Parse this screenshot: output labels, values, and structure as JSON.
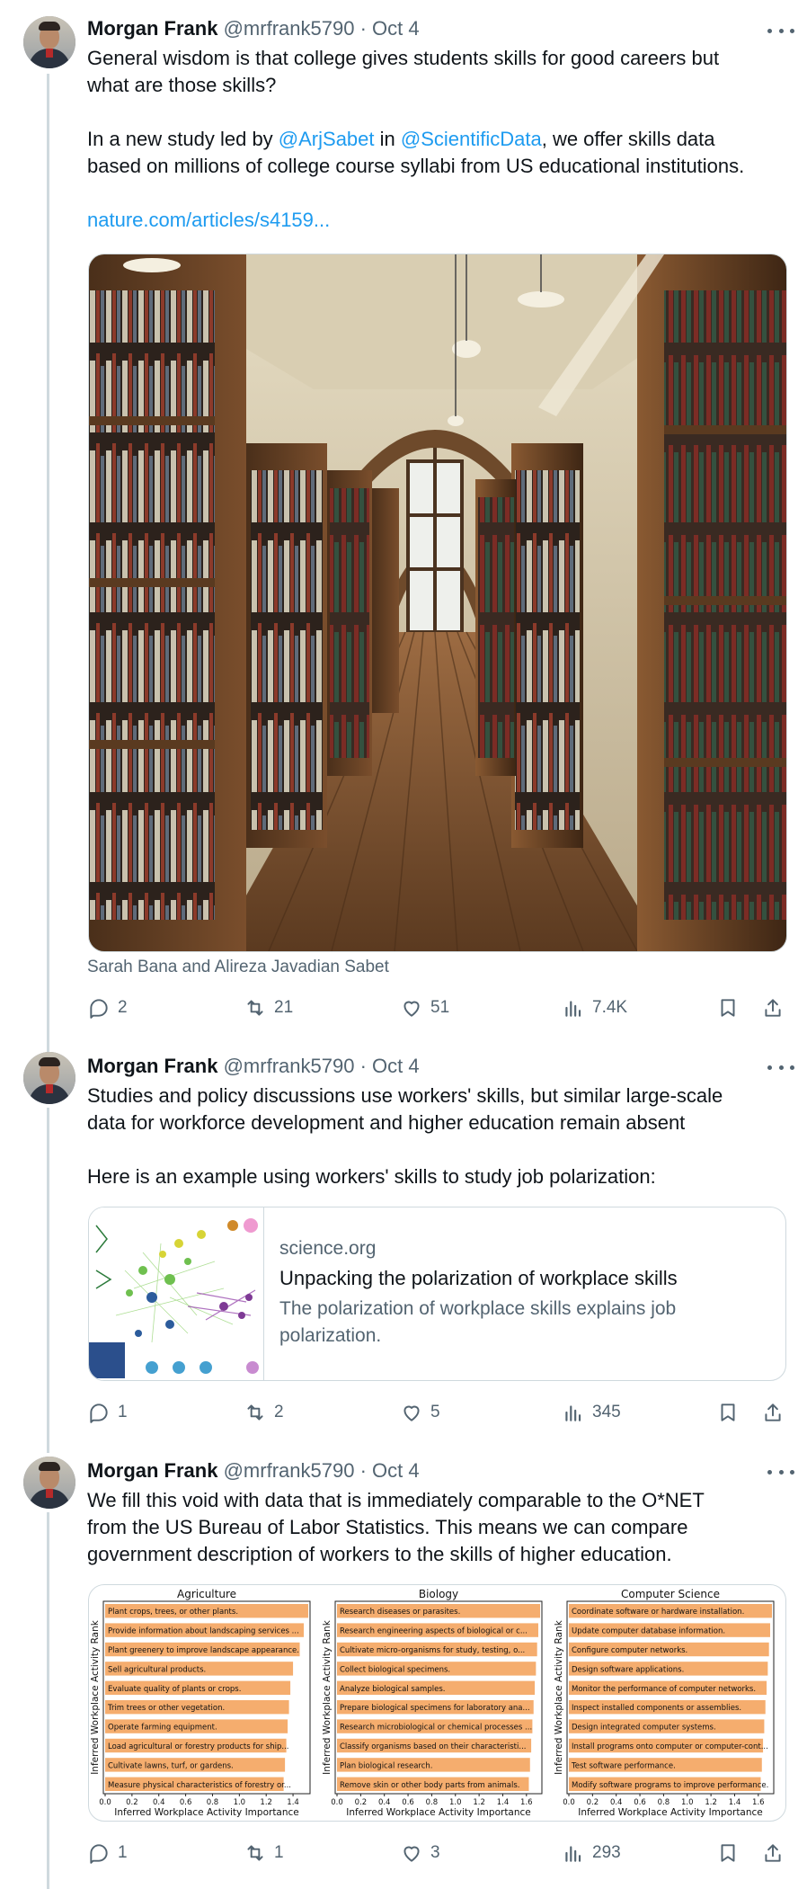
{
  "tweets": [
    {
      "name": "Morgan Frank",
      "handle": "@mrfrank5790",
      "dot": "·",
      "date": "Oct 4",
      "text_lines": [
        "General wisdom is that college gives students skills for good careers but",
        "what are those skills?"
      ],
      "para2_prefix": "In a new study led by ",
      "mention1": "@ArjSabet",
      "para2_mid": " in ",
      "mention2": "@ScientificData",
      "para2_suffix": ", we offer skills data",
      "para2_line2": "based on millions of college course syllabi from US educational institutions.",
      "link": "nature.com/articles/s4159...",
      "caption": "Sarah Bana and Alireza Javadian Sabet",
      "replies": "2",
      "retweets": "21",
      "likes": "51",
      "views": "7.4K"
    },
    {
      "name": "Morgan Frank",
      "handle": "@mrfrank5790",
      "dot": "·",
      "date": "Oct 4",
      "text_lines": [
        "Studies and policy discussions use workers' skills, but similar large-scale",
        "data for workforce development and higher education remain absent"
      ],
      "text_line3": "Here is an example using workers' skills to study job polarization:",
      "card": {
        "domain": "science.org",
        "title": "Unpacking the polarization of workplace skills",
        "description": "The polarization of workplace skills explains job polarization."
      },
      "replies": "1",
      "retweets": "2",
      "likes": "5",
      "views": "345"
    },
    {
      "name": "Morgan Frank",
      "handle": "@mrfrank5790",
      "dot": "·",
      "date": "Oct 4",
      "text_lines": [
        "We fill this void with data that is immediately comparable to the O*NET",
        "from the US Bureau of Labor Statistics. This means we can compare",
        "government description of workers to the skills of higher education."
      ],
      "replies": "1",
      "retweets": "1",
      "likes": "3",
      "views": "293"
    }
  ],
  "chart_data": [
    {
      "type": "bar",
      "title": "Agriculture",
      "ylabel": "Inferred Workplace Activity Rank",
      "xlabel": "Inferred Workplace Activity Importance",
      "xlim": [
        0,
        1.5
      ],
      "xticks": [
        "0.0",
        "0.2",
        "0.4",
        "0.6",
        "0.8",
        "1.0",
        "1.2",
        "1.4"
      ],
      "bar_color": "#f5ad6e",
      "categories": [
        "Plant crops, trees, or other plants.",
        "Provide information about landscaping services ...",
        "Plant greenery to improve landscape appearance.",
        "Sell agricultural products.",
        "Evaluate quality of plants or crops.",
        "Trim trees or other vegetation.",
        "Operate farming equipment.",
        "Load agricultural or forestry products for ship...",
        "Cultivate lawns, turf, or gardens.",
        "Measure physical characteristics of forestry or..."
      ],
      "values": [
        1.55,
        1.48,
        1.45,
        1.4,
        1.38,
        1.37,
        1.36,
        1.35,
        1.34,
        1.33
      ]
    },
    {
      "type": "bar",
      "title": "Biology",
      "ylabel": "Inferred Workplace Activity Rank",
      "xlabel": "Inferred Workplace Activity Importance",
      "xlim": [
        0,
        1.7
      ],
      "xticks": [
        "0.0",
        "0.2",
        "0.4",
        "0.6",
        "0.8",
        "1.0",
        "1.2",
        "1.4",
        "1.6"
      ],
      "bar_color": "#f5ad6e",
      "categories": [
        "Research diseases or parasites.",
        "Research engineering aspects of biological or c...",
        "Cultivate micro-organisms for study, testing, o...",
        "Collect biological specimens.",
        "Analyze biological samples.",
        "Prepare biological specimens for laboratory ana...",
        "Research microbiological or chemical processes ...",
        "Classify organisms based on their characteristi...",
        "Plan biological research.",
        "Remove skin or other body parts from animals."
      ],
      "values": [
        1.74,
        1.7,
        1.69,
        1.68,
        1.67,
        1.66,
        1.65,
        1.64,
        1.63,
        1.62
      ]
    },
    {
      "type": "bar",
      "title": "Computer Science",
      "ylabel": "Inferred Workplace Activity Rank",
      "xlabel": "Inferred Workplace Activity Importance",
      "xlim": [
        0,
        1.7
      ],
      "xticks": [
        "0.0",
        "0.2",
        "0.4",
        "0.6",
        "0.8",
        "1.0",
        "1.2",
        "1.4",
        "1.6"
      ],
      "bar_color": "#f5ad6e",
      "categories": [
        "Coordinate software or hardware installation.",
        "Update computer database information.",
        "Configure computer networks.",
        "Design software applications.",
        "Monitor the performance of computer networks.",
        "Inspect installed components or assemblies.",
        "Design integrated computer systems.",
        "Install programs onto computer or computer-cont...",
        "Test software performance.",
        "Modify software programs to improve performance."
      ],
      "values": [
        1.72,
        1.7,
        1.69,
        1.68,
        1.67,
        1.66,
        1.65,
        1.64,
        1.63,
        1.62
      ]
    }
  ]
}
